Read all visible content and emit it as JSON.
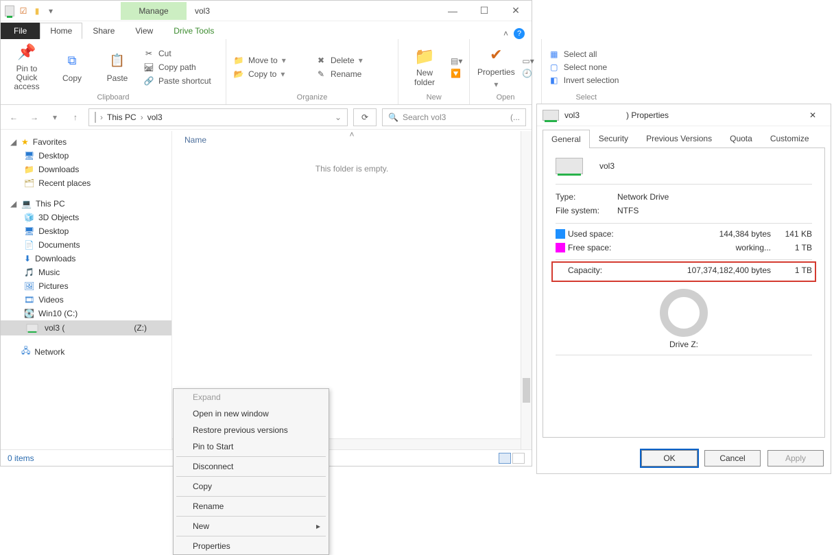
{
  "explorer": {
    "title_manage": "Manage",
    "title_vol": "vol3",
    "tabs": {
      "file": "File",
      "home": "Home",
      "share": "Share",
      "view": "View",
      "drive_tools": "Drive Tools"
    },
    "ribbon": {
      "pin": "Pin to Quick access",
      "copy": "Copy",
      "paste": "Paste",
      "cut": "Cut",
      "copy_path": "Copy path",
      "paste_shortcut": "Paste shortcut",
      "clipboard": "Clipboard",
      "move_to": "Move to",
      "copy_to": "Copy to",
      "delete": "Delete",
      "rename": "Rename",
      "organize": "Organize",
      "new_folder": "New folder",
      "new": "New",
      "properties": "Properties",
      "open": "Open",
      "select_all": "Select all",
      "select_none": "Select none",
      "invert": "Invert selection",
      "select": "Select"
    },
    "path": {
      "root": "This PC",
      "vol": "vol3"
    },
    "search_placeholder": "Search vol3",
    "search_suffix": "(...",
    "column_name": "Name",
    "empty_msg": "This folder is empty.",
    "tree": {
      "favorites": "Favorites",
      "desktop": "Desktop",
      "downloads": "Downloads",
      "recent": "Recent places",
      "this_pc": "This PC",
      "objects3d": "3D Objects",
      "desktop2": "Desktop",
      "documents": "Documents",
      "downloads2": "Downloads",
      "music": "Music",
      "pictures": "Pictures",
      "videos": "Videos",
      "win10": "Win10 (C:)",
      "vol3": "vol3 (",
      "vol3_drive": "(Z:)",
      "network": "Network"
    },
    "status_items": "0 items"
  },
  "context_menu": {
    "expand": "Expand",
    "open_new": "Open in new window",
    "restore": "Restore previous versions",
    "pin_start": "Pin to Start",
    "disconnect": "Disconnect",
    "copy": "Copy",
    "rename": "Rename",
    "new": "New",
    "properties": "Properties"
  },
  "properties": {
    "title_prefix": "vol3",
    "title_suffix": ") Properties",
    "tabs": [
      "General",
      "Security",
      "Previous Versions",
      "Quota",
      "Customize"
    ],
    "name": "vol3",
    "type_label": "Type:",
    "type_value": "Network Drive",
    "fs_label": "File system:",
    "fs_value": "NTFS",
    "used_label": "Used space:",
    "used_bytes": "144,384 bytes",
    "used_h": "141 KB",
    "free_label": "Free space:",
    "free_bytes": "working...",
    "free_h": "1 TB",
    "cap_label": "Capacity:",
    "cap_bytes": "107,374,182,400 bytes",
    "cap_h": "1 TB",
    "drive_label": "Drive Z:",
    "ok": "OK",
    "cancel": "Cancel",
    "apply": "Apply"
  }
}
